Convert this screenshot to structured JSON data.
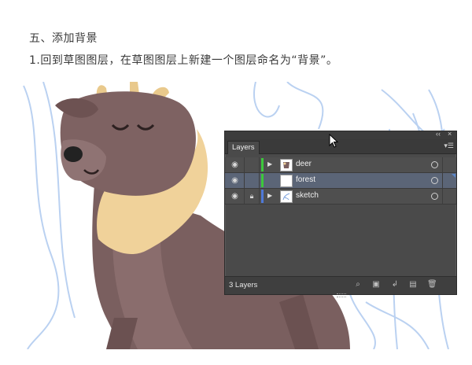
{
  "article": {
    "heading": "五、添加背景",
    "instruction": "1.回到草图图层，在草图图层上新建一个图层命名为“背景”。"
  },
  "layers_panel": {
    "tab_label": "Layers",
    "collapse_icon": "double-chevron-left-icon",
    "close_icon": "close-icon",
    "menu_icon": "panel-menu-icon",
    "layers": [
      {
        "name": "deer",
        "color": "#3cc83c",
        "visible": true,
        "locked": false,
        "expandable": true,
        "thumb": "deer-thumbnail",
        "selected": false
      },
      {
        "name": "forest",
        "color": "#3cc83c",
        "visible": true,
        "locked": false,
        "expandable": false,
        "thumb": "blank-thumbnail",
        "selected": true
      },
      {
        "name": "sketch",
        "color": "#4f79d8",
        "visible": true,
        "locked": true,
        "expandable": true,
        "thumb": "sketch-thumbnail",
        "selected": false
      }
    ],
    "footer_count": "3 Layers",
    "footer_icons": [
      "locate-object-icon",
      "make-clipping-mask-icon",
      "create-sublayer-icon",
      "new-layer-icon",
      "delete-icon"
    ],
    "selection_color": "#5b6577"
  }
}
